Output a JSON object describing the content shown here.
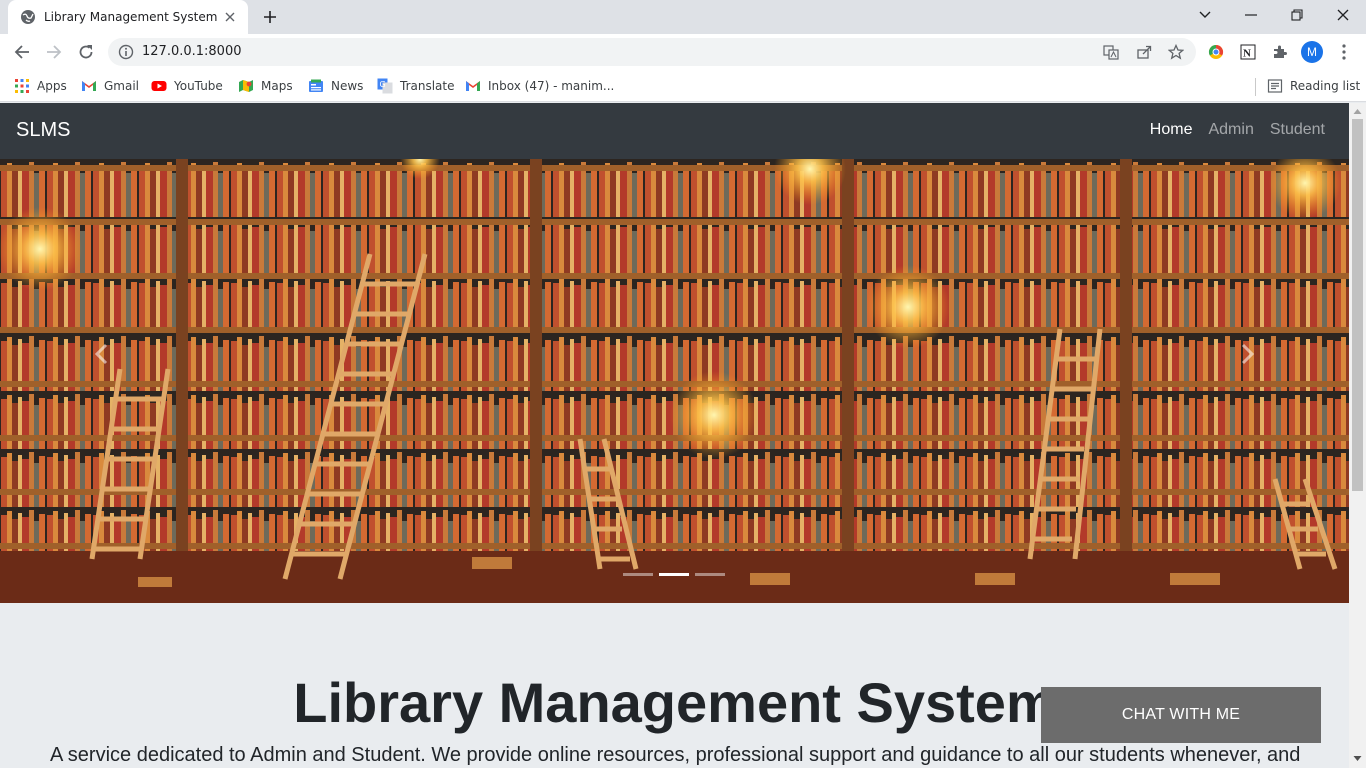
{
  "browser": {
    "tab_title": "Library Management System",
    "url": "127.0.0.1:8000",
    "avatar_letter": "M",
    "bookmarks": [
      {
        "label": "Apps",
        "icon": "apps-grid-icon"
      },
      {
        "label": "Gmail",
        "icon": "gmail-icon"
      },
      {
        "label": "YouTube",
        "icon": "youtube-icon"
      },
      {
        "label": "Maps",
        "icon": "maps-icon"
      },
      {
        "label": "News",
        "icon": "news-icon"
      },
      {
        "label": "Translate",
        "icon": "translate-icon"
      },
      {
        "label": "Inbox (47) - manim...",
        "icon": "gmail-icon"
      }
    ],
    "reading_list": "Reading list"
  },
  "navbar": {
    "brand": "SLMS",
    "links": [
      {
        "label": "Home",
        "active": true
      },
      {
        "label": "Admin",
        "active": false
      },
      {
        "label": "Student",
        "active": false
      }
    ],
    "bg_color": "#343a40"
  },
  "carousel": {
    "image": "library-bookshelves-with-ladders",
    "slide_count": 3,
    "active_slide": 2
  },
  "hero": {
    "title": "Library Management System",
    "lead": "A service dedicated to Admin and Student. We provide online resources, professional support and guidance to all our students whenever, and"
  },
  "chat_button": {
    "label": "CHAT WITH ME",
    "color": "#6c6c6c"
  }
}
